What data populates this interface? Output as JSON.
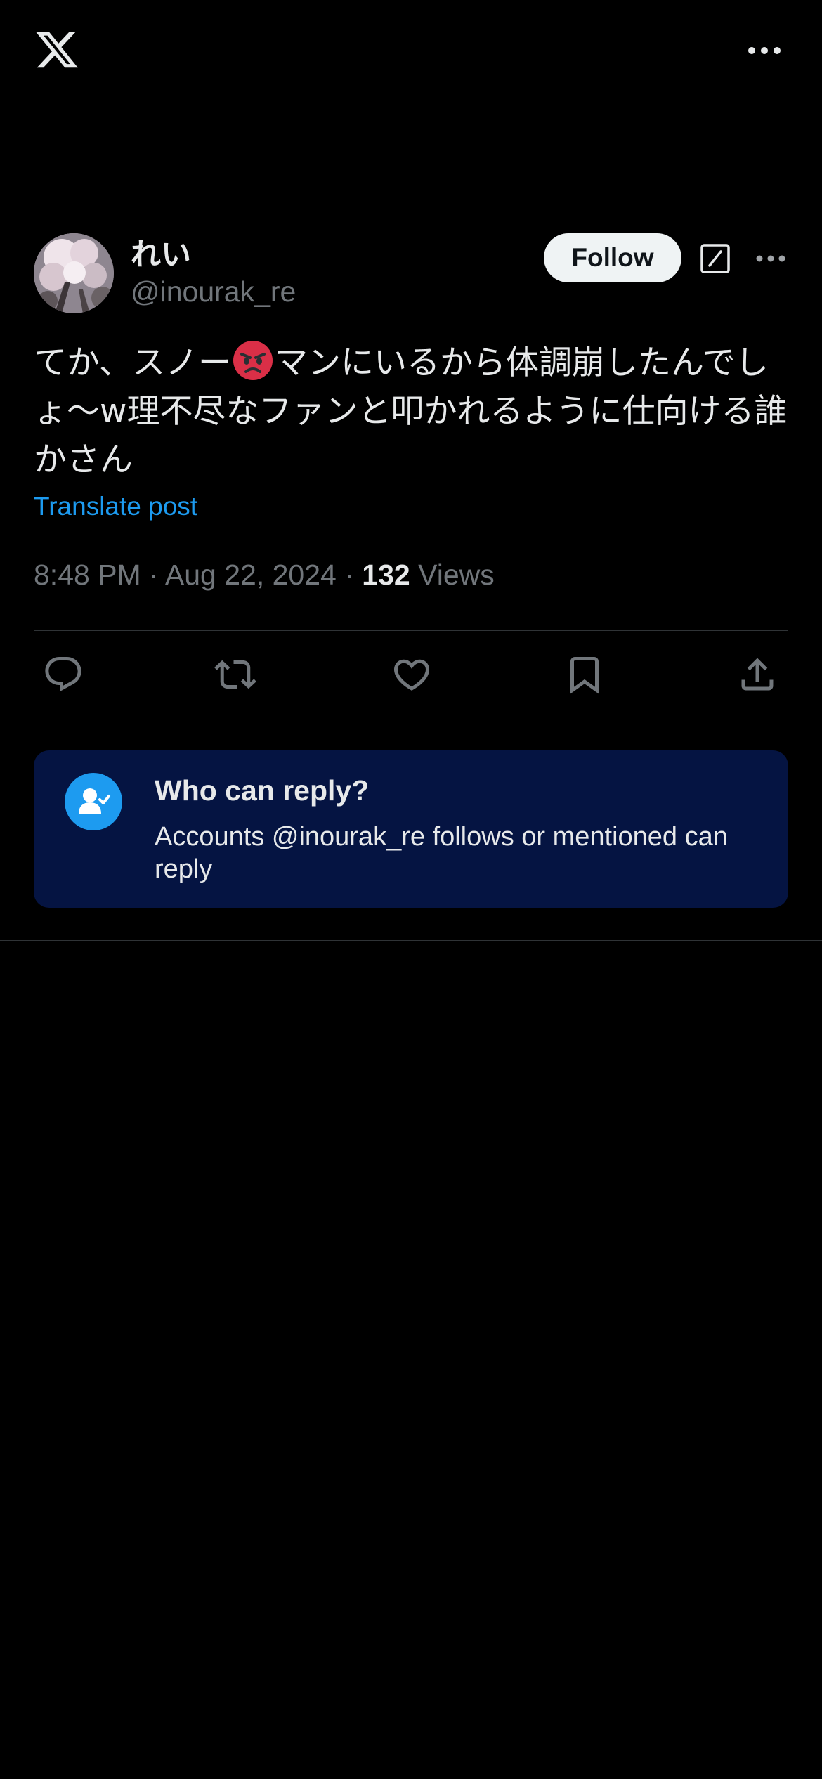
{
  "header": {
    "logo_icon": "x-logo-icon",
    "more_icon": "more-horizontal-icon"
  },
  "post": {
    "author": {
      "display_name": "れい",
      "handle": "@inourak_re"
    },
    "follow_label": "Follow",
    "text_before_emoji": "てか、スノー",
    "emoji": "angry-face-emoji",
    "text_after_emoji": "マンにいるから体調崩したんでしょ〜w理不尽なファンと叩かれるように仕向ける誰かさん",
    "translate_label": "Translate post",
    "time": "8:48 PM",
    "separator": " · ",
    "date": "Aug 22, 2024",
    "views_count": "132",
    "views_label": "Views"
  },
  "actions": [
    {
      "icon": "reply-icon"
    },
    {
      "icon": "repost-icon"
    },
    {
      "icon": "like-icon"
    },
    {
      "icon": "bookmark-icon"
    },
    {
      "icon": "share-icon"
    }
  ],
  "reply_restriction": {
    "title": "Who can reply?",
    "description": "Accounts @inourak_re follows or mentioned can reply"
  },
  "colors": {
    "background": "#000000",
    "text_primary": "#e7e9ea",
    "text_secondary": "#71767b",
    "accent": "#1d9bf0",
    "card_background": "#051442",
    "follow_button_bg": "#eff3f4"
  }
}
